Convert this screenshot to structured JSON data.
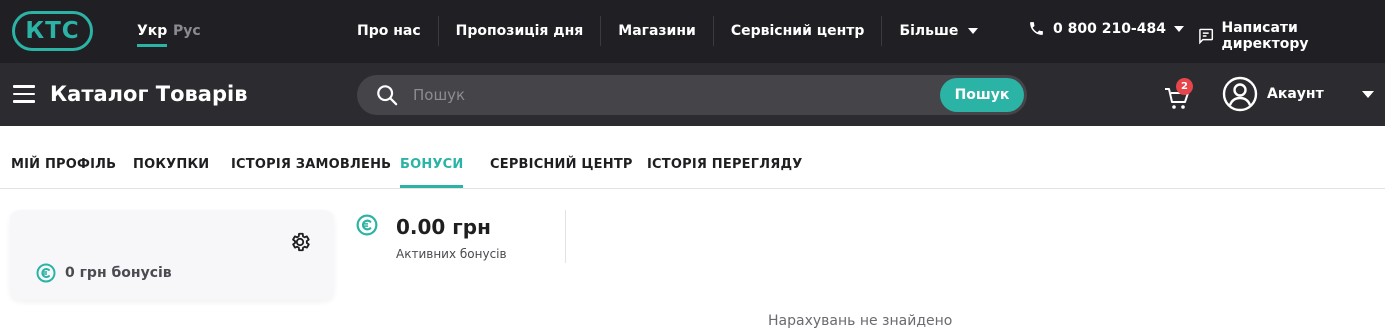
{
  "header": {
    "logo_text": "КТС",
    "languages": {
      "active": "Укр",
      "inactive": "Рус"
    },
    "nav": [
      "Про нас",
      "Пропозиція дня",
      "Магазини",
      "Сервісний центр",
      "Більше"
    ],
    "phone": "0 800 210-484",
    "director_link": "Написати директору"
  },
  "mainbar": {
    "catalog_title": "Каталог Товарів",
    "search_placeholder": "Пошук",
    "search_button": "Пошук",
    "cart_count": "2",
    "account_label": "Акаунт"
  },
  "tabs": [
    "МІЙ ПРОФІЛЬ",
    "ПОКУПКИ",
    "ІСТОРІЯ ЗАМОВЛЕНЬ",
    "БОНУСИ",
    "СЕРВІСНИЙ ЦЕНТР",
    "ІСТОРІЯ ПЕРЕГЛЯДУ"
  ],
  "active_tab": "БОНУСИ",
  "profile_card": {
    "bonus_text": "0 грн бонусів"
  },
  "bonus_summary": {
    "amount": "0.00 грн",
    "label": "Активних бонусів"
  },
  "empty_note": "Нарахувань не знайдено",
  "colors": {
    "accent": "#2bb3a6",
    "topbar": "#202024",
    "mainbar": "#2c2c30",
    "badge": "#e5454b"
  }
}
